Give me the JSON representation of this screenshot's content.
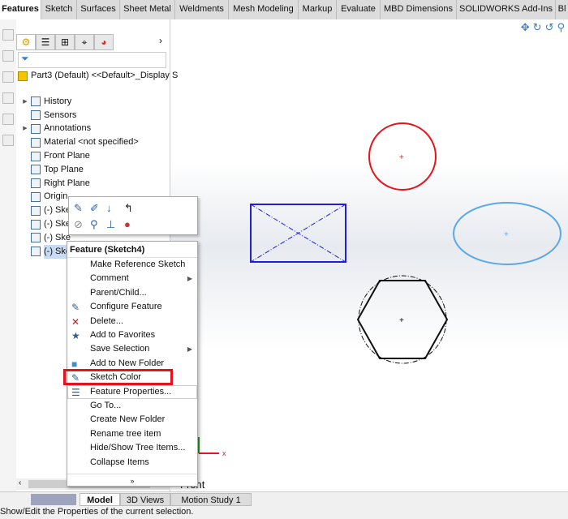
{
  "command_manager": {
    "tabs": [
      "Features",
      "Sketch",
      "Surfaces",
      "Sheet Metal",
      "Weldments",
      "Mesh Modeling",
      "Markup",
      "Evaluate",
      "MBD Dimensions",
      "SOLIDWORKS Add-Ins",
      "Bl"
    ],
    "active": "Features"
  },
  "panel": {
    "tabs": [
      "featuremanager-icon",
      "propertymanager-icon",
      "configurationmanager-icon",
      "dimxpert-icon",
      "display-manager-icon"
    ],
    "tree": [
      {
        "label": "Part3 (Default) <<Default>_Display S",
        "icon": "part-icon"
      },
      {
        "label": "History",
        "icon": "history-icon",
        "expand": true
      },
      {
        "label": "Sensors",
        "icon": "sensors-icon"
      },
      {
        "label": "Annotations",
        "icon": "annotations-icon",
        "expand": true
      },
      {
        "label": "Material <not specified>",
        "icon": "material-icon"
      },
      {
        "label": "Front Plane",
        "icon": "plane-icon"
      },
      {
        "label": "Top Plane",
        "icon": "plane-icon"
      },
      {
        "label": "Right Plane",
        "icon": "plane-icon"
      },
      {
        "label": "Origin",
        "icon": "origin-icon"
      },
      {
        "label": "(-) Sketch1",
        "icon": "sketch-icon"
      },
      {
        "label": "(-) Ske",
        "icon": "sketch-icon"
      },
      {
        "label": "(-) Ske",
        "icon": "sketch-icon"
      },
      {
        "label": "(-) Sketch4",
        "icon": "sketch-icon",
        "selected": true
      }
    ]
  },
  "context_menu": {
    "title": "Feature (Sketch4)",
    "items": [
      {
        "label": "Make Reference Sketch"
      },
      {
        "label": "Comment",
        "submenu": true
      },
      {
        "label": "Parent/Child..."
      },
      {
        "label": "Configure Feature",
        "icon": "configure-feature-icon"
      },
      {
        "label": "Delete...",
        "icon": "delete-icon"
      },
      {
        "label": "Add to Favorites",
        "icon": "favorites-icon"
      },
      {
        "label": "Save Selection",
        "submenu": true
      },
      {
        "label": "Add to New Folder",
        "icon": "folder-icon"
      },
      {
        "label": "Sketch Color",
        "icon": "sketch-color-icon",
        "highlighted_box": true
      },
      {
        "label": "Feature Properties...",
        "icon": "properties-icon",
        "hover": true
      },
      {
        "label": "Go To..."
      },
      {
        "label": "Create New Folder"
      },
      {
        "label": "Rename tree item"
      },
      {
        "label": "Hide/Show Tree Items..."
      },
      {
        "label": "Collapse Items"
      }
    ],
    "more": "»"
  },
  "bottom_tabs": [
    "Model",
    "3D Views",
    "Motion Study 1"
  ],
  "view_label": "Front",
  "axis_label": "x",
  "status": "Show/Edit the Properties of the current selection.",
  "colors": {
    "highlight_box": "#e4121f",
    "circle": "#e8141c",
    "rectangle": "#1f1fd6",
    "ellipse": "#5aa8e8",
    "hexagon": "#111111"
  }
}
